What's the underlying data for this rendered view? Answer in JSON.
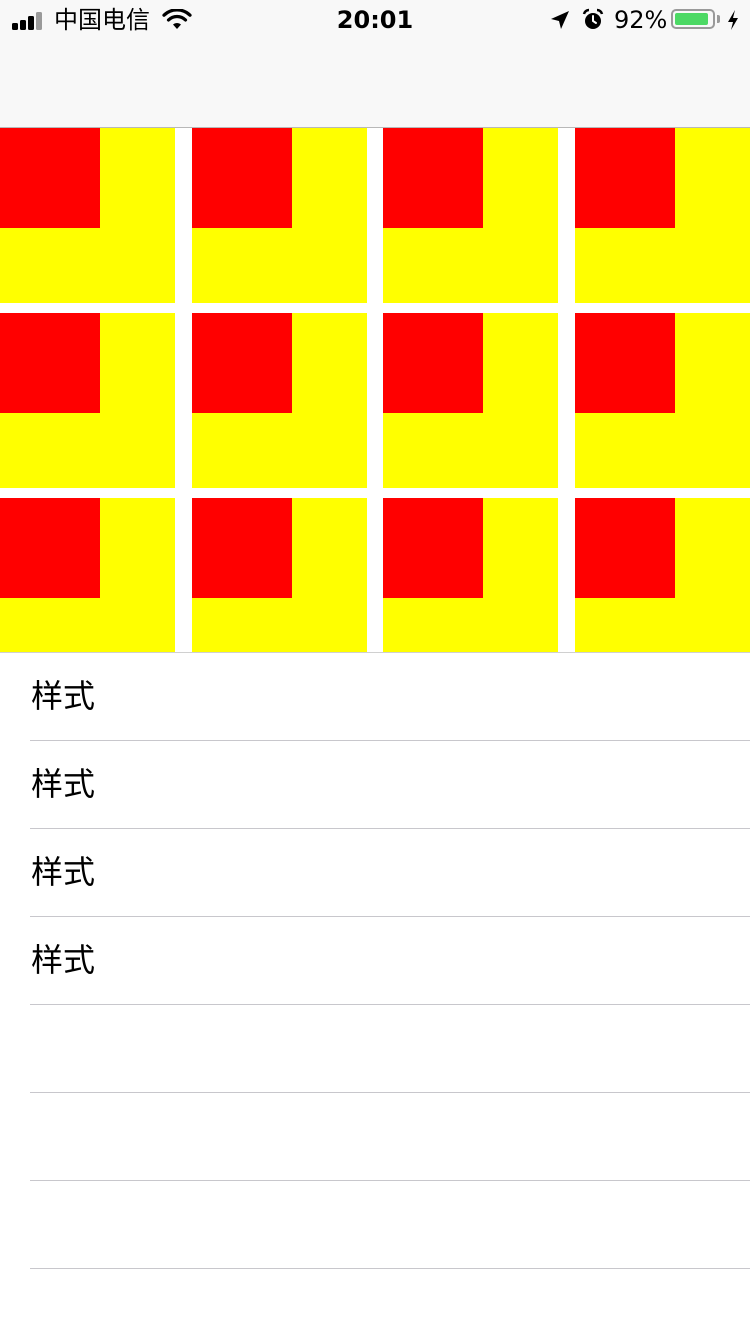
{
  "status_bar": {
    "carrier": "中国电信",
    "time": "20:01",
    "battery_percent": "92%",
    "battery_level": 0.92,
    "icons": [
      "signal-icon",
      "wifi-icon",
      "location-icon",
      "alarm-icon",
      "battery-icon",
      "charging-icon"
    ]
  },
  "nav_bar": {
    "title": ""
  },
  "grid": {
    "rows": 3,
    "columns": 4,
    "outer_color": "#ffff00",
    "inner_color": "#ff0000",
    "cells": [
      {},
      {},
      {},
      {},
      {},
      {},
      {},
      {},
      {},
      {},
      {},
      {}
    ]
  },
  "list": {
    "rows": [
      {
        "label": "样式"
      },
      {
        "label": "样式"
      },
      {
        "label": "样式"
      },
      {
        "label": "样式"
      },
      {
        "label": ""
      },
      {
        "label": ""
      },
      {
        "label": ""
      }
    ]
  },
  "colors": {
    "battery_green": "#4cd964",
    "separator": "#c8c7cc",
    "bar_background": "#f8f8f8"
  }
}
